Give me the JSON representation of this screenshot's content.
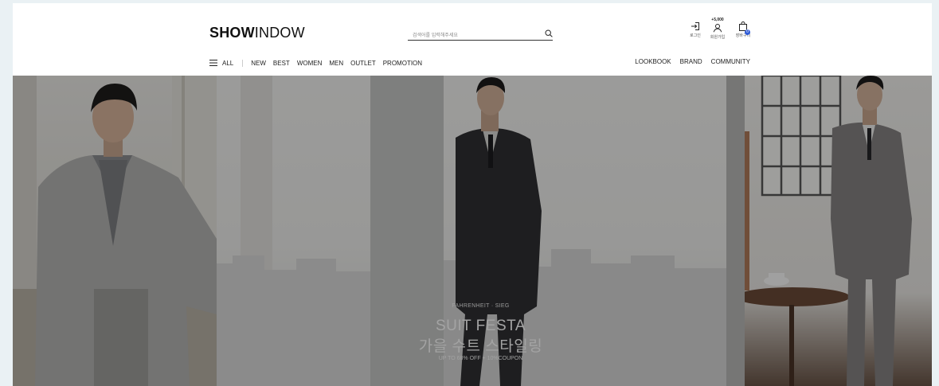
{
  "header": {
    "logo_bold": "SHOW",
    "logo_light": "INDOW",
    "search_placeholder": "검색어를 입력해주세요",
    "utility": {
      "login_label": "로그인",
      "join_promo": "+5,000",
      "join_label": "회원가입",
      "cart_label": "장바구니",
      "cart_count": "0"
    }
  },
  "nav": {
    "all_label": "ALL",
    "left_items": [
      "NEW",
      "BEST",
      "WOMEN",
      "MEN",
      "OUTLET",
      "PROMOTION"
    ],
    "right_items": [
      "LOOKBOOK",
      "BRAND",
      "COMMUNITY"
    ]
  },
  "hero": {
    "brand": "FAHRENHEIT · SIEG",
    "title": "SUIT FESTA",
    "subtitle": "가을 수트 스타일링",
    "offer": "UP TO 68% OFF + 10%COUPON"
  },
  "colors": {
    "accent": "#2f5bd6",
    "overlay": "rgba(0,0,0,0.36)",
    "page_bg": "#eaf1f4"
  }
}
